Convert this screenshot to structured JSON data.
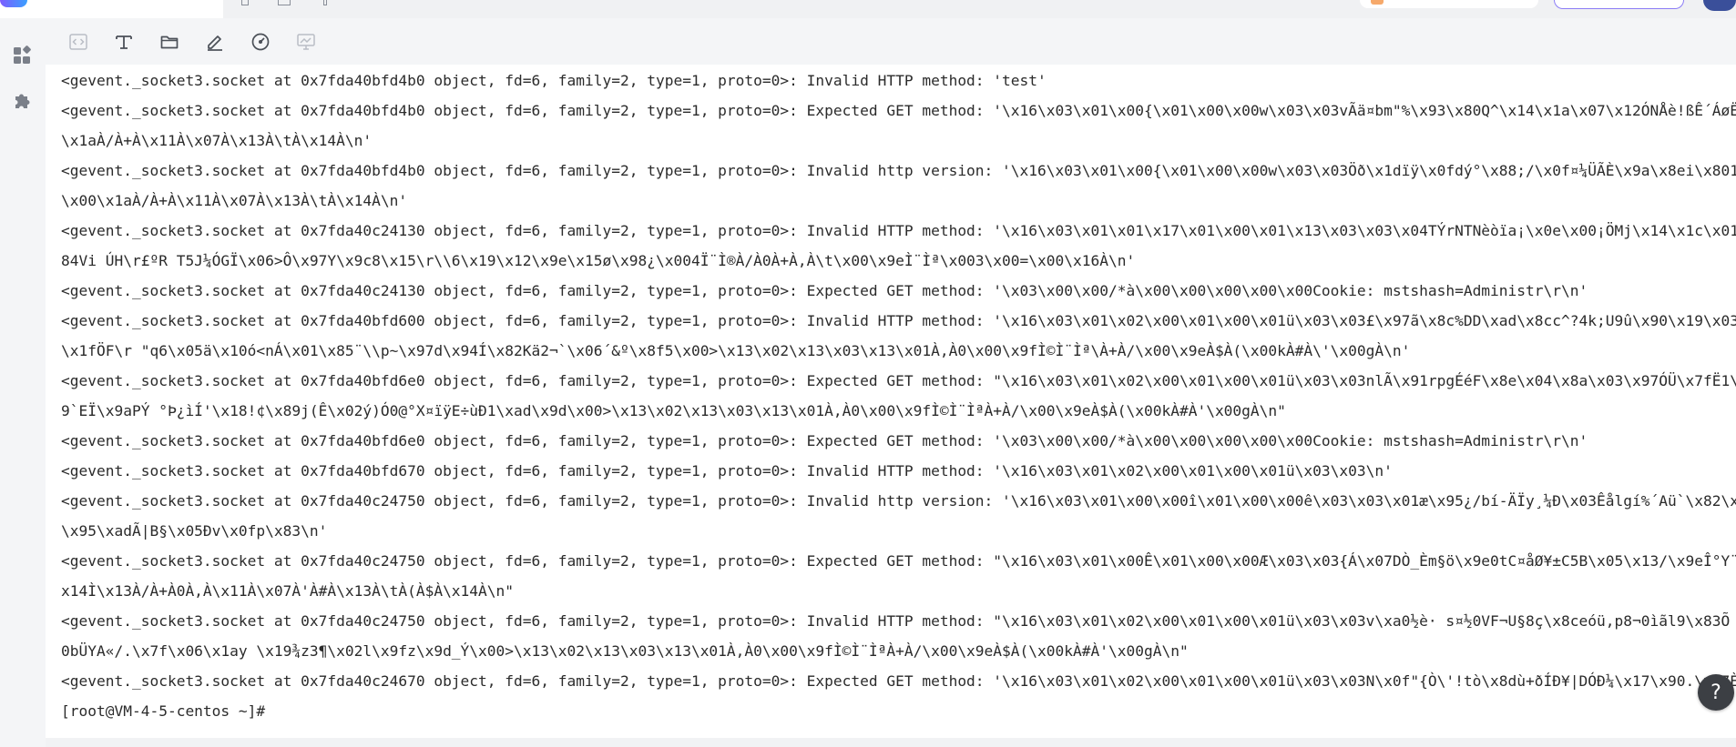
{
  "sidebar": {
    "items": [
      {
        "icon": "dashboard-grid-icon"
      },
      {
        "icon": "puzzle-plugin-icon"
      }
    ]
  },
  "toolbar": {
    "tools": [
      {
        "icon": "code-brackets-icon",
        "enabled": false
      },
      {
        "icon": "text-format-icon",
        "enabled": true
      },
      {
        "icon": "folder-icon",
        "enabled": true
      },
      {
        "icon": "pen-edit-icon",
        "enabled": true
      },
      {
        "icon": "gauge-icon",
        "enabled": true
      },
      {
        "icon": "monitor-chart-icon",
        "enabled": false
      }
    ]
  },
  "terminal": {
    "lines": [
      "<gevent._socket3.socket at 0x7fda40bfd4b0 object, fd=6, family=2, type=1, proto=0>: Invalid HTTP method: 'test'",
      "<gevent._socket3.socket at 0x7fda40bfd4b0 object, fd=6, family=2, type=1, proto=0>: Expected GET method: '\\x16\\x03\\x01\\x00{\\x01\\x00\\x00w\\x03\\x03vÃä¤bm\"%\\x93\\x80Q^\\x14\\x1a\\x07\\x12ÓNÅè!ßÊ´ÁøË1\\xadÊ0.\\x00\\x00",
      "\\x1aÀ/À+À\\x11À\\x07À\\x13À\\tÀ\\x14À\\n'",
      "<gevent._socket3.socket at 0x7fda40bfd4b0 object, fd=6, family=2, type=1, proto=0>: Invalid http version: '\\x16\\x03\\x01\\x00{\\x01\\x00\\x00w\\x03\\x03Öð\\x1dïÿ\\x0fdý°\\x88;/\\x0f¤¼ÜÃÈ\\x9a\\x8ei\\x801Ëï±ö-¶ÎÌ\\x10\\x00",
      "\\x00\\x1aÀ/À+À\\x11À\\x07À\\x13À\\tÀ\\x14À\\n'",
      "<gevent._socket3.socket at 0x7fda40c24130 object, fd=6, family=2, type=1, proto=0>: Invalid HTTP method: '\\x16\\x03\\x01\\x01\\x17\\x01\\x00\\x01\\x13\\x03\\x03\\x04TÝrNTNèòïa¡\\x0e\\x00¡ÖMj\\x14\\x1c\\x01(é?Gqê\\x8c\\xad\\",
      "84Vi ÚH\\r£ºR T5J¼ÓGÏ\\x06>Ô\\x97Y\\x9c8\\x15\\r\\\\6\\x19\\x12\\x9e\\x15ø\\x98¿\\x004Ï¨Ì®À/À0À+À,À\\t\\x00\\x9eÌ¨Ìª\\x003\\x00=\\x00\\x16À\\n'",
      "<gevent._socket3.socket at 0x7fda40c24130 object, fd=6, family=2, type=1, proto=0>: Expected GET method: '\\x03\\x00\\x00/*à\\x00\\x00\\x00\\x00\\x00Cookie: mstshash=Administr\\r\\n'",
      "<gevent._socket3.socket at 0x7fda40bfd600 object, fd=6, family=2, type=1, proto=0>: Invalid HTTP method: '\\x16\\x03\\x01\\x02\\x00\\x01\\x00\\x01ü\\x03\\x03£\\x97ã\\x8c%DD\\xad\\x8cc^?4k;U9û\\x90\\x19\\x03¢\\x1e\\x91±\\x9aĐ",
      "\\x1fÖF\\r \"q6\\x05ä\\x10ó<nÁ\\x01\\x85¨\\\\p~\\x97d\\x94Í\\x82Kä2¬`\\x06´&º\\x8f5\\x00>\\x13\\x02\\x13\\x03\\x13\\x01À,À0\\x00\\x9fÌ©Ì¨Ìª\\À+À/\\x00\\x9eÀ$À(\\x00kÀ#À\\'\\x00gÀ\\n'",
      "<gevent._socket3.socket at 0x7fda40bfd6e0 object, fd=6, family=2, type=1, proto=0>: Expected GET method: \"\\x16\\x03\\x01\\x02\\x00\\x01\\x00\\x01ü\\x03\\x03nlÃ\\x91rpgÉéF\\x8e\\x04\\x8a\\x03\\x97ÓÜ\\x7fË1\\x0e\\x18¼\\x07P\\x8",
      "9`EÏ\\x9aPÝ °Þ¿ìÍ'\\x18!¢\\x89j(Ê\\x02ý)Ó0@°X¤ïÿE÷ùÐ1\\xad\\x9d\\x00>\\x13\\x02\\x13\\x03\\x13\\x01À,À0\\x00\\x9fÌ©Ì¨ÌªÀ+À/\\x00\\x9eÀ$À(\\x00kÀ#À'\\x00gÀ\\n\"",
      "<gevent._socket3.socket at 0x7fda40bfd6e0 object, fd=6, family=2, type=1, proto=0>: Expected GET method: '\\x03\\x00\\x00/*à\\x00\\x00\\x00\\x00\\x00Cookie: mstshash=Administr\\r\\n'",
      "<gevent._socket3.socket at 0x7fda40bfd670 object, fd=6, family=2, type=1, proto=0>: Invalid HTTP method: '\\x16\\x03\\x01\\x02\\x00\\x01\\x00\\x01ü\\x03\\x03\\n'",
      "<gevent._socket3.socket at 0x7fda40c24750 object, fd=6, family=2, type=1, proto=0>: Invalid http version: '\\x16\\x03\\x01\\x00\\x00î\\x01\\x00\\x00ê\\x03\\x03\\x01æ\\x95¿/bí-ÄÏy¸¼Ð\\x03Êålgí%´Aü`\\x82\\x0b\\x1f·©JÕ ït\\x0eIð",
      "\\x95\\xadÃ|B§\\x05Ðv\\x0fp\\x83\\n'",
      "<gevent._socket3.socket at 0x7fda40c24750 object, fd=6, family=2, type=1, proto=0>: Expected GET method: \"\\x16\\x03\\x01\\x00Ê\\x01\\x00\\x00Æ\\x03\\x03{Á\\x07DÒ_Èm§ö\\x9e0tC¤åØ¥±C5B\\x05\\x13/\\x9eÎ°Y¨Í\\x80\\x00\\x00hÌ",
      "x14Ì\\x13À/À+À0À,À\\x11À\\x07À'À#À\\x13À\\tÀ(À$À\\x14À\\n\"",
      "<gevent._socket3.socket at 0x7fda40c24750 object, fd=6, family=2, type=1, proto=0>: Invalid HTTP method: \"\\x16\\x03\\x01\\x02\\x00\\x01\\x00\\x01ü\\x03\\x03v\\xa0½è· s¤½0VF¬U§8ç\\x8ceóü,p8¬0ìãl9\\x83Õ ±g§mì\\x07i\\xa0\\",
      "0bÜYA«/.\\x7f\\x06\\x1ay \\x19¾z3¶\\x02l\\x9fz\\x9d_Ý\\x00>\\x13\\x02\\x13\\x03\\x13\\x01À,À0\\x00\\x9fÌ©Ì¨ÌªÀ+À/\\x00\\x9eÀ$À(\\x00kÀ#À'\\x00gÀ\\n\"",
      "<gevent._socket3.socket at 0x7fda40c24670 object, fd=6, family=2, type=1, proto=0>: Expected GET method: '\\x16\\x03\\x01\\x02\\x00\\x01\\x00\\x01ü\\x03\\x03N\\x0f\"{Ò\\'!tò\\x8dù+ðÍÐ¥|DÓÐ¼\\x17\\x90.\\x17È·Í\\x08\\x9f1",
      "[root@VM-4-5-centos ~]#"
    ]
  },
  "help_button": {
    "label": "?"
  },
  "colors": {
    "text": "#2b2b2b",
    "panel": "#f4f5f7",
    "accent": "#8b7cf6"
  }
}
